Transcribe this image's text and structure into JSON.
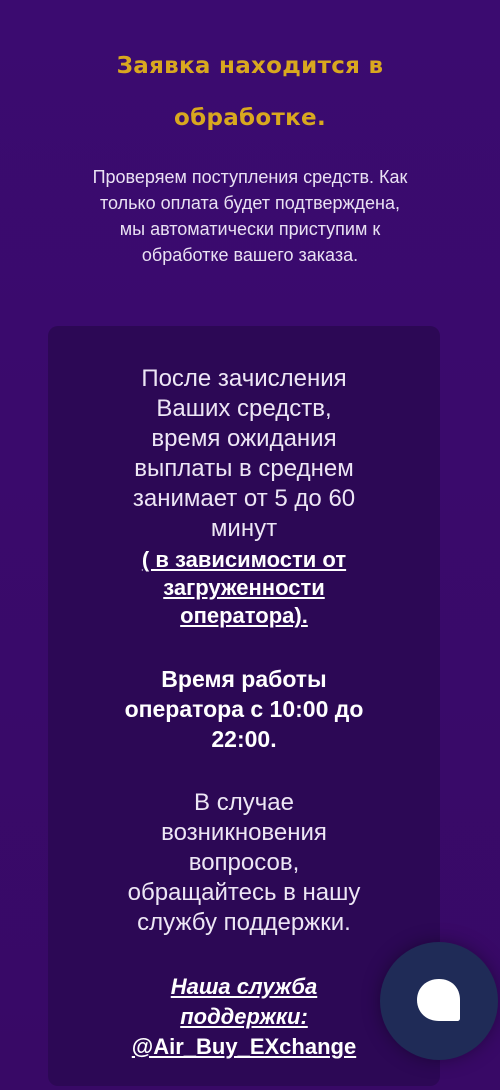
{
  "header": {
    "title_line1": "Заявка находится в",
    "title_line2": "обработке."
  },
  "subtitle": {
    "line1": "Проверяем поступления средств. Как",
    "line2": "только оплата будет подтверждена,",
    "line3": "мы автоматически приступим к",
    "line4": "обработке вашего заказа."
  },
  "card": {
    "wait_lines": [
      "После зачисления",
      "Ваших средств,",
      "время ожидания",
      "выплаты в среднем",
      "занимает от 5 до 60",
      "минут"
    ],
    "wait_link_lines": [
      "( в зависимости от",
      "загруженности",
      "оператора)."
    ],
    "hours_lines": [
      "Время работы",
      "оператора с 10:00 до",
      "22:00."
    ],
    "questions_lines": [
      "В случае",
      "возникновения",
      "вопросов,",
      "обращайтесь в нашу",
      "службу поддержки."
    ],
    "support_lines": [
      "Наша служба",
      "поддержки:"
    ],
    "support_handle": "@Air_Buy_EXchange"
  },
  "chat": {
    "icon": "chat-bubble-icon"
  },
  "colors": {
    "background": "#3b0b70",
    "card": "#2c0855",
    "title": "#d9a81f",
    "chat_button": "#1f2b57"
  }
}
